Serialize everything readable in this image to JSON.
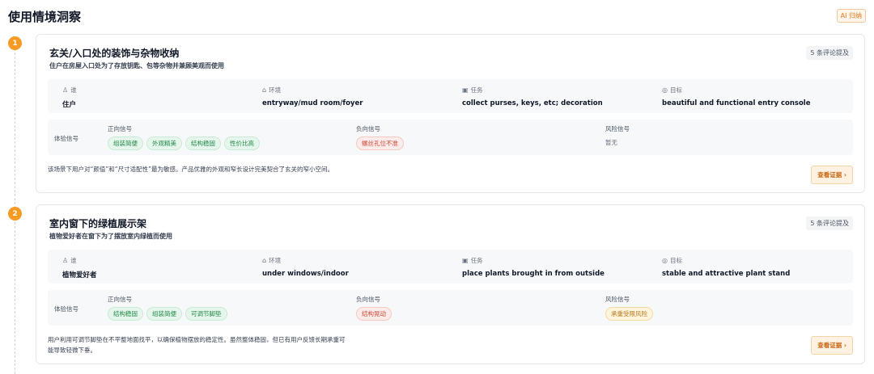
{
  "page": {
    "title": "使用情境洞察",
    "ai_badge": "AI 归纳"
  },
  "attr_labels": {
    "who": "谁",
    "where": "环境",
    "task": "任务",
    "goal": "目标"
  },
  "signal_labels": {
    "title": "体验信号",
    "positive": "正向信号",
    "negative": "负向信号",
    "risk": "风险信号"
  },
  "cards": [
    {
      "number": "1",
      "title": "玄关/入口处的装饰与杂物收纳",
      "subtitle": "住户在房屋入口处为了存放钥匙、包等杂物并兼顾美观而使用",
      "count": "5 条评论提及",
      "who": "住户",
      "where": "entryway/mud room/foyer",
      "task": "collect purses, keys, etc; decoration",
      "goal": "beautiful and functional entry console",
      "positive": [
        "组装简便",
        "外观精美",
        "结构稳固",
        "性价比高"
      ],
      "negative": [
        "螺丝孔位不准"
      ],
      "risk_none": "暂无",
      "summary": "该场景下用户对“颜值”和“尺寸适配性”最为敏感。产品优雅的外观和窄长设计完美契合了玄关的窄小空间。",
      "evidence": "查看证据 ›"
    },
    {
      "number": "2",
      "title": "室内窗下的绿植展示架",
      "subtitle": "植物爱好者在窗下为了摆放室内绿植而使用",
      "count": "5 条评论提及",
      "who": "植物爱好者",
      "where": "under windows/indoor",
      "task": "place plants brought in from outside",
      "goal": "stable and attractive plant stand",
      "positive": [
        "结构稳固",
        "组装简便",
        "可调节脚垫"
      ],
      "negative": [
        "结构晃动"
      ],
      "risk": [
        "承重受限风险"
      ],
      "summary": "用户利用可调节脚垫在不平整地面找平，以确保植物摆放的稳定性。虽然整体稳固，但已有用户反馈长期承重可能导致轻微下垂。",
      "evidence": "查看证据 ›"
    }
  ]
}
